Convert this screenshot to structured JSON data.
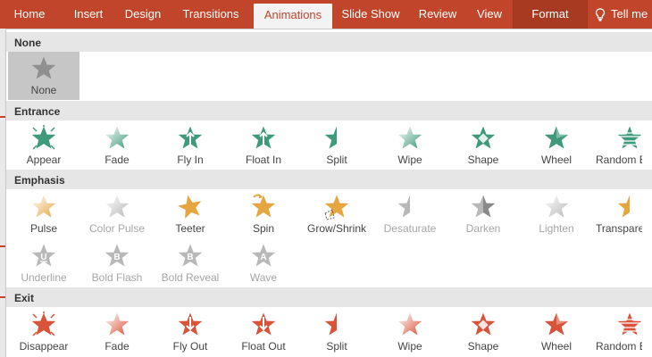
{
  "ribbon": {
    "tabs": [
      "Home",
      "Insert",
      "Design",
      "Transitions",
      "Animations",
      "Slide Show",
      "Review",
      "View",
      "Format"
    ],
    "active_tab": "Animations",
    "tell_me": "Tell me"
  },
  "gallery": {
    "none": {
      "header": "None",
      "items": [
        {
          "label": "None",
          "icon": "star-gray-icon",
          "selected": true
        }
      ]
    },
    "entrance": {
      "header": "Entrance",
      "items": [
        {
          "label": "Appear",
          "icon": "star-burst-green-icon"
        },
        {
          "label": "Fade",
          "icon": "star-fade-green-icon"
        },
        {
          "label": "Fly In",
          "icon": "star-arrow-up-green-icon"
        },
        {
          "label": "Float In",
          "icon": "star-arrow-up-green-icon"
        },
        {
          "label": "Split",
          "icon": "star-split-green-icon"
        },
        {
          "label": "Wipe",
          "icon": "star-wipe-green-icon"
        },
        {
          "label": "Shape",
          "icon": "star-shape-green-icon"
        },
        {
          "label": "Wheel",
          "icon": "star-wheel-green-icon"
        },
        {
          "label": "Random Bars",
          "icon": "star-bars-green-icon"
        }
      ]
    },
    "emphasis": {
      "header": "Emphasis",
      "row1": [
        {
          "label": "Pulse",
          "icon": "star-pulse-gold-icon",
          "disabled": false
        },
        {
          "label": "Color Pulse",
          "icon": "star-color-pulse-gray-icon",
          "disabled": true
        },
        {
          "label": "Teeter",
          "icon": "star-teeter-gold-icon",
          "disabled": false
        },
        {
          "label": "Spin",
          "icon": "star-spin-gold-icon",
          "disabled": false
        },
        {
          "label": "Grow/Shrink",
          "icon": "star-grow-gold-icon",
          "disabled": false
        },
        {
          "label": "Desaturate",
          "icon": "star-desaturate-gray-icon",
          "disabled": true
        },
        {
          "label": "Darken",
          "icon": "star-darken-gray-icon",
          "disabled": true
        },
        {
          "label": "Lighten",
          "icon": "star-lighten-gray-icon",
          "disabled": true
        },
        {
          "label": "Transparency",
          "icon": "star-transparency-gold-icon",
          "disabled": false
        }
      ],
      "row2": [
        {
          "label": "Underline",
          "icon": "star-underline-gray-icon",
          "glyph": "U",
          "disabled": true
        },
        {
          "label": "Bold Flash",
          "icon": "star-bold-flash-gray-icon",
          "glyph": "B",
          "disabled": true
        },
        {
          "label": "Bold Reveal",
          "icon": "star-bold-reveal-gray-icon",
          "glyph": "B",
          "disabled": true
        },
        {
          "label": "Wave",
          "icon": "star-wave-gray-icon",
          "glyph": "A",
          "disabled": true
        }
      ]
    },
    "exit": {
      "header": "Exit",
      "items": [
        {
          "label": "Disappear",
          "icon": "star-burst-red-icon"
        },
        {
          "label": "Fade",
          "icon": "star-fade-red-icon"
        },
        {
          "label": "Fly Out",
          "icon": "star-arrow-down-red-icon"
        },
        {
          "label": "Float Out",
          "icon": "star-arrow-down-red-icon"
        },
        {
          "label": "Split",
          "icon": "star-split-red-icon"
        },
        {
          "label": "Wipe",
          "icon": "star-wipe-red-icon"
        },
        {
          "label": "Shape",
          "icon": "star-shape-red-icon"
        },
        {
          "label": "Wheel",
          "icon": "star-wheel-red-icon"
        },
        {
          "label": "Random Bars",
          "icon": "star-bars-red-icon"
        }
      ]
    }
  },
  "colors": {
    "ribbon": "#c0452b",
    "entrance": "#3f9a7b",
    "emphasis": "#e5a640",
    "exit": "#d9533a",
    "disabled": "#b8b8b8"
  }
}
